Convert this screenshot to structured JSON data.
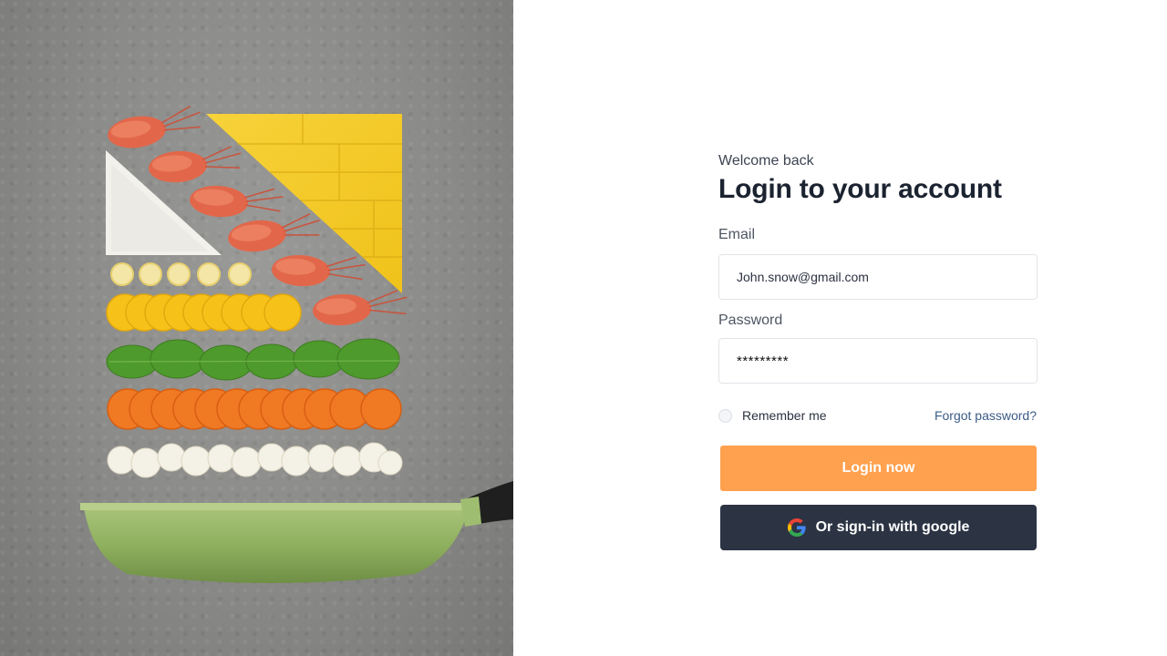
{
  "image": {
    "description_icon": "food-flatlay-image"
  },
  "login": {
    "welcome": "Welcome back",
    "title": "Login to your account",
    "email_label": "Email",
    "email_value": "John.snow@gmail.com",
    "password_label": "Password",
    "password_value": "*********",
    "remember_label": "Remember me",
    "remember_checked": false,
    "forgot_label": "Forgot password?",
    "login_button": "Login now",
    "google_button": "Or sign-in with google",
    "google_icon": "google-icon"
  },
  "colors": {
    "accent": "#ffa14e",
    "dark_button": "#2c3444",
    "link": "#3b5b86",
    "title": "#1b2230"
  }
}
